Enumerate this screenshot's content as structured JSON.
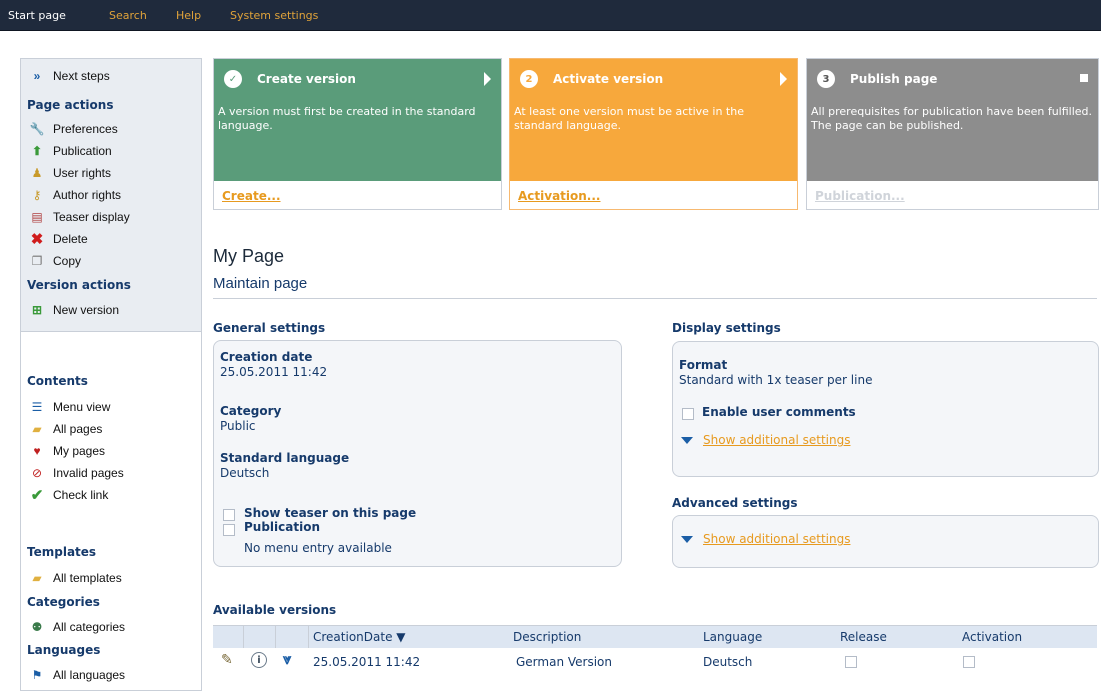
{
  "topnav": [
    {
      "label": "Start page",
      "active": true
    },
    {
      "label": "Search",
      "active": false
    },
    {
      "label": "Help",
      "active": false
    },
    {
      "label": "System settings",
      "active": false
    }
  ],
  "sidebar": {
    "next_steps": "Next steps",
    "page_actions": "Page actions",
    "page_action_items": [
      "Preferences",
      "Publication",
      "User rights",
      "Author rights",
      "Teaser display",
      "Delete",
      "Copy"
    ],
    "version_actions": "Version actions",
    "new_version": "New version",
    "contents": "Contents",
    "contents_items": [
      "Menu view",
      "All pages",
      "My pages",
      "Invalid pages",
      "Check link"
    ],
    "templates": "Templates",
    "all_templates": "All templates",
    "categories": "Categories",
    "all_categories": "All categories",
    "languages": "Languages",
    "all_languages": "All languages"
  },
  "steps": [
    {
      "num": "✓",
      "title": "Create version",
      "text": "A version must first be created in the standard language.",
      "action": "Create...",
      "color": "#5a9c7a"
    },
    {
      "num": "2",
      "title": "Activate version",
      "text": "At least one version must be active in the standard language.",
      "action": "Activation...",
      "color": "#f7a83c"
    },
    {
      "num": "3",
      "title": "Publish page",
      "text": "All prerequisites for publication have been fulfilled. The page can be published.",
      "action": "Publication...",
      "color": "#8d8d8d"
    }
  ],
  "page": {
    "title": "My Page",
    "subtitle": "Maintain page"
  },
  "general": {
    "title": "General settings",
    "creation_date_label": "Creation date",
    "creation_date": "25.05.2011 11:42",
    "category_label": "Category",
    "category": "Public",
    "standard_language_label": "Standard language",
    "standard_language": "Deutsch",
    "show_teaser": "Show teaser on this page",
    "publication": "Publication",
    "no_menu": "No menu entry available"
  },
  "display": {
    "title": "Display settings",
    "format_label": "Format",
    "format": "Standard with 1x teaser per line",
    "enable_comments": "Enable user comments",
    "show_additional": "Show additional settings"
  },
  "advanced": {
    "title": "Advanced settings",
    "show_additional": "Show additional settings"
  },
  "versions": {
    "title": "Available versions",
    "columns": [
      "CreationDate ▼",
      "Description",
      "Language",
      "Release",
      "Activation"
    ],
    "rows": [
      {
        "date": "25.05.2011 11:42",
        "description": "German Version",
        "language": "Deutsch"
      }
    ]
  }
}
